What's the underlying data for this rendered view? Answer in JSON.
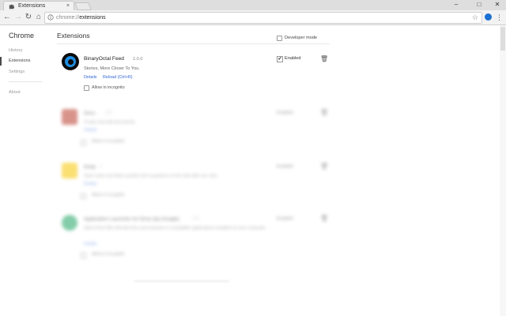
{
  "browser": {
    "tab_title": "Extensions",
    "tab_close": "×",
    "url_scheme": "chrome://",
    "url_path": "extensions",
    "controls": {
      "minimize": "–",
      "maximize": "□",
      "close": "✕"
    },
    "nav": {
      "back": "←",
      "forward": "→",
      "reload": "↻",
      "home": "⌂"
    },
    "star": "☆",
    "menu": "⋮"
  },
  "sidebar": {
    "brand": "Chrome",
    "items": [
      {
        "label": "History"
      },
      {
        "label": "Extensions"
      },
      {
        "label": "Settings"
      },
      {
        "label": "About"
      }
    ]
  },
  "main": {
    "title": "Extensions",
    "developer_mode_label": "Developer mode"
  },
  "extension": {
    "name": "BinaryOctal Feed",
    "version": "1.0.0",
    "description": "Stories, More Closer To You.",
    "details_link": "Details",
    "reload_link": "Reload (Ctrl+R)",
    "incognito_label": "Allow in incognito",
    "enabled_label": "Enabled",
    "enabled_mark": "✔",
    "trash": "🗑"
  },
  "blurred_items": [
    {
      "name": "Docs",
      "version": "0.2",
      "description": "Create and edit documents",
      "link": "Details",
      "incognito": "Allow in incognito",
      "enabled": "Enabled",
      "icon_color": "#b83c2b"
    },
    {
      "name": "Keep",
      "version": "1",
      "description": "Save notes and ideas quickly from anywhere on the web with one click",
      "link": "Details",
      "incognito": "Allow in incognito",
      "enabled": "Enabled",
      "icon_color": "#f7c600"
    },
    {
      "name": "Application Launcher for Drive (by Google)",
      "version": "3.2",
      "description": "Open Drive files directly from your browser in compatible applications installed on your computer.",
      "link": "Details",
      "incognito": "Allow in incognito",
      "enabled": "Enabled",
      "icon_color": "#1fa463"
    }
  ]
}
